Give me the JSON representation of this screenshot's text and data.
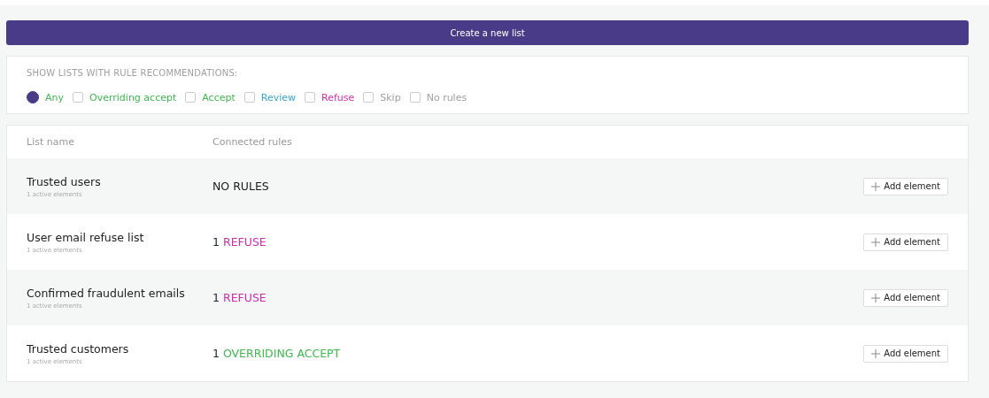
{
  "create_button": {
    "label": "Create a new list"
  },
  "filter": {
    "title": "SHOW LISTS WITH RULE RECOMMENDATIONS:",
    "options": [
      {
        "label": "Any",
        "selected": true,
        "color": "#3fba4f"
      },
      {
        "label": "Overriding accept",
        "selected": false,
        "color": "#3fba4f"
      },
      {
        "label": "Accept",
        "selected": false,
        "color": "#3fba4f"
      },
      {
        "label": "Review",
        "selected": false,
        "color": "#3aa6cf"
      },
      {
        "label": "Refuse",
        "selected": false,
        "color": "#d12fb0"
      },
      {
        "label": "Skip",
        "selected": false,
        "color": "#a0a0a0"
      },
      {
        "label": "No rules",
        "selected": false,
        "color": "#a0a0a0"
      }
    ]
  },
  "table": {
    "columns": [
      "List name",
      "Connected rules"
    ],
    "rows": [
      {
        "name": "Trusted users",
        "subtitle": "1 active elements",
        "rule": {
          "label": "NO RULES",
          "color": "#1a1a1a"
        },
        "button": "Add element"
      },
      {
        "name": "User email refuse list",
        "subtitle": "1 active elements",
        "rule": {
          "count": "1",
          "label": "REFUSE",
          "color": "#d12fb0"
        },
        "button": "Add element"
      },
      {
        "name": "Confirmed fraudulent emails",
        "subtitle": "1 active elements",
        "rule": {
          "count": "1",
          "label": "REFUSE",
          "color": "#d12fb0"
        },
        "button": "Add element"
      },
      {
        "name": "Trusted customers",
        "subtitle": "1 active elements",
        "rule": {
          "count": "1",
          "label": "OVERRIDING ACCEPT",
          "color": "#3fba4f"
        },
        "button": "Add element"
      }
    ]
  }
}
